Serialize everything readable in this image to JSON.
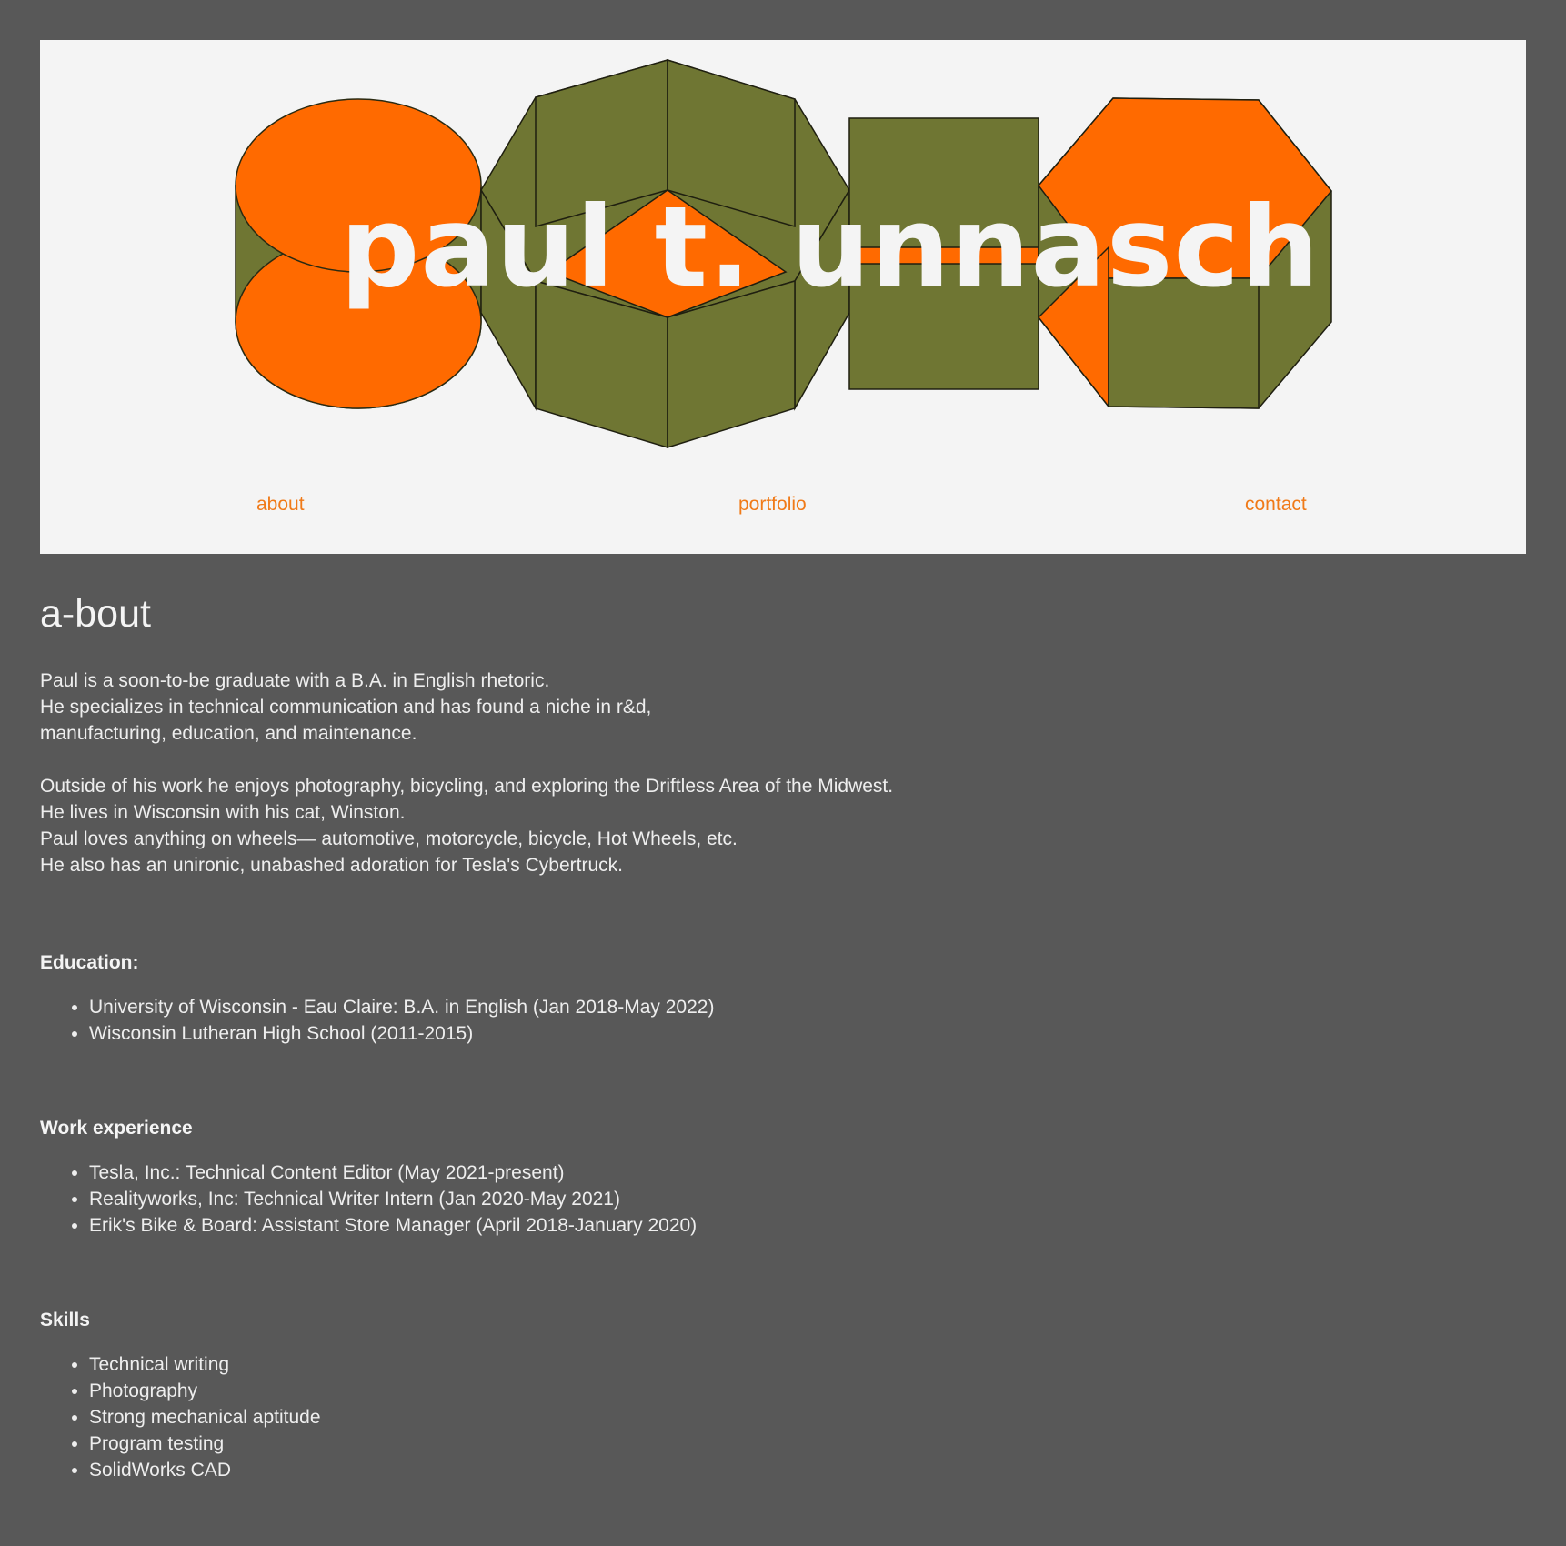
{
  "header": {
    "site_title": "paul t. unnasch",
    "logo_name": "geometric-shapes-logo",
    "colors": {
      "orange": "#ff6a00",
      "olive": "#6f7633",
      "panel": "#f4f4f4",
      "nav_link": "#f07a18"
    }
  },
  "nav": {
    "about": "about",
    "portfolio": "portfolio",
    "contact": "contact"
  },
  "main": {
    "heading": "a-bout",
    "intro_lines": [
      "Paul is a soon-to-be graduate with a B.A. in English rhetoric.",
      "He specializes in technical communication and has found a niche in r&d,",
      "manufacturing, education, and maintenance."
    ],
    "personal_lines": [
      "Outside of his work he enjoys photography, bicycling, and exploring the Driftless Area of the Midwest.",
      "He lives in Wisconsin with his cat, Winston.",
      "Paul loves anything on wheels— automotive, motorcycle, bicycle, Hot Wheels, etc.",
      "He also has an unironic, unabashed adoration for Tesla's Cybertruck."
    ],
    "education": {
      "heading": "Education:",
      "items": [
        "University of Wisconsin - Eau Claire: B.A. in English (Jan 2018-May 2022)",
        "Wisconsin Lutheran High School (2011-2015)"
      ]
    },
    "work": {
      "heading": "Work experience",
      "items": [
        "Tesla, Inc.: Technical Content Editor (May 2021-present)",
        "Realityworks, Inc: Technical Writer Intern (Jan 2020-May 2021)",
        "Erik's Bike & Board: Assistant Store Manager (April 2018-January 2020)"
      ]
    },
    "skills": {
      "heading": "Skills",
      "items": [
        "Technical writing",
        "Photography",
        "Strong mechanical aptitude",
        "Program testing",
        "SolidWorks CAD"
      ]
    }
  }
}
